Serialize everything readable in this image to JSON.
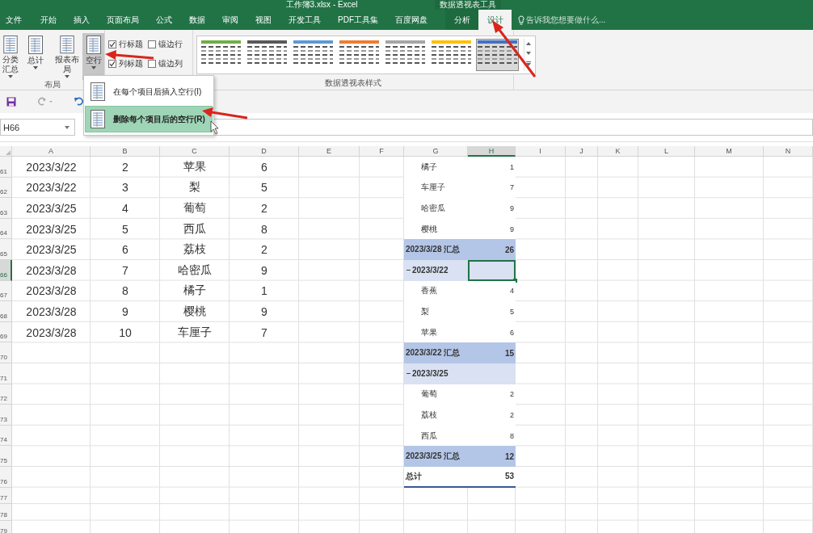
{
  "window": {
    "title": "工作簿3.xlsx - Excel",
    "context_label": "数据透视表工具"
  },
  "ribbon_tabs": [
    {
      "label": "文件",
      "kind": "normal",
      "selected": false
    },
    {
      "label": "开始",
      "kind": "normal",
      "selected": false
    },
    {
      "label": "插入",
      "kind": "normal",
      "selected": false
    },
    {
      "label": "页面布局",
      "kind": "normal",
      "selected": false
    },
    {
      "label": "公式",
      "kind": "normal",
      "selected": false
    },
    {
      "label": "数据",
      "kind": "normal",
      "selected": false
    },
    {
      "label": "审阅",
      "kind": "normal",
      "selected": false
    },
    {
      "label": "视图",
      "kind": "normal",
      "selected": false
    },
    {
      "label": "开发工具",
      "kind": "normal",
      "selected": false
    },
    {
      "label": "PDF工具集",
      "kind": "normal",
      "selected": false
    },
    {
      "label": "百度网盘",
      "kind": "normal",
      "selected": false
    },
    {
      "label": "分析",
      "kind": "context",
      "selected": false
    },
    {
      "label": "设计",
      "kind": "context",
      "selected": true
    }
  ],
  "tell_me": {
    "placeholder": "告诉我您想要做什么..."
  },
  "layout_group": {
    "label": "布局",
    "buttons": [
      {
        "label": "分类汇总",
        "pressed": false
      },
      {
        "label": "总计",
        "pressed": false
      },
      {
        "label": "报表布局",
        "pressed": false
      },
      {
        "label": "空行",
        "pressed": true
      }
    ]
  },
  "style_options": [
    {
      "label": "行标题",
      "checked": true
    },
    {
      "label": "镶边行",
      "checked": false
    },
    {
      "label": "列标题",
      "checked": true
    },
    {
      "label": "镶边列",
      "checked": false
    }
  ],
  "styles_group": {
    "label": "数据透视表样式",
    "swatches": [
      {
        "color": "#70ad47",
        "selected": false
      },
      {
        "color": "#595959",
        "selected": false
      },
      {
        "color": "#5b9bd5",
        "selected": false
      },
      {
        "color": "#ed7d31",
        "selected": false
      },
      {
        "color": "#a5a5a5",
        "selected": false
      },
      {
        "color": "#ffc000",
        "selected": false
      },
      {
        "color": "#4472c4",
        "selected": true
      }
    ]
  },
  "name_box": {
    "value": "H66"
  },
  "dropdown_menu": {
    "items": [
      {
        "label": "在每个项目后插入空行(I)",
        "selected": false
      },
      {
        "label": "删除每个项目后的空行(R)",
        "selected": true
      }
    ]
  },
  "sheet": {
    "columns": [
      {
        "label": "A",
        "selected": false
      },
      {
        "label": "B",
        "selected": false
      },
      {
        "label": "C",
        "selected": false
      },
      {
        "label": "D",
        "selected": false
      },
      {
        "label": "E",
        "selected": false
      },
      {
        "label": "F",
        "selected": false
      },
      {
        "label": "G",
        "selected": false
      },
      {
        "label": "H",
        "selected": true
      },
      {
        "label": "I",
        "selected": false
      },
      {
        "label": "J",
        "selected": false
      },
      {
        "label": "K",
        "selected": false
      },
      {
        "label": "L",
        "selected": false
      },
      {
        "label": "M",
        "selected": false
      },
      {
        "label": "N",
        "selected": false
      }
    ],
    "rows": [
      {
        "number": "61",
        "selected": false,
        "cells": [
          "2023/3/22",
          "2",
          "苹果",
          "6"
        ],
        "pivot": {
          "kind": "item",
          "label": "橘子",
          "value": "1"
        }
      },
      {
        "number": "62",
        "selected": false,
        "cells": [
          "2023/3/22",
          "3",
          "梨",
          "5"
        ],
        "pivot": {
          "kind": "item",
          "label": "车厘子",
          "value": "7"
        }
      },
      {
        "number": "63",
        "selected": false,
        "cells": [
          "2023/3/25",
          "4",
          "葡萄",
          "2"
        ],
        "pivot": {
          "kind": "item",
          "label": "哈密瓜",
          "value": "9"
        }
      },
      {
        "number": "64",
        "selected": false,
        "cells": [
          "2023/3/25",
          "5",
          "西瓜",
          "8"
        ],
        "pivot": {
          "kind": "item",
          "label": "樱桃",
          "value": "9"
        }
      },
      {
        "number": "65",
        "selected": false,
        "cells": [
          "2023/3/25",
          "6",
          "荔枝",
          "2"
        ],
        "pivot": {
          "kind": "subtotal",
          "label": "2023/3/28 汇总",
          "value": "26"
        }
      },
      {
        "number": "66",
        "selected": true,
        "cells": [
          "2023/3/28",
          "7",
          "哈密瓜",
          "9"
        ],
        "pivot": {
          "kind": "group",
          "label": "2023/3/22"
        }
      },
      {
        "number": "67",
        "selected": false,
        "cells": [
          "2023/3/28",
          "8",
          "橘子",
          "1"
        ],
        "pivot": {
          "kind": "item",
          "label": "香蕉",
          "value": "4"
        }
      },
      {
        "number": "68",
        "selected": false,
        "cells": [
          "2023/3/28",
          "9",
          "樱桃",
          "9"
        ],
        "pivot": {
          "kind": "item",
          "label": "梨",
          "value": "5"
        }
      },
      {
        "number": "69",
        "selected": false,
        "cells": [
          "2023/3/28",
          "10",
          "车厘子",
          "7"
        ],
        "pivot": {
          "kind": "item",
          "label": "苹果",
          "value": "6"
        }
      },
      {
        "number": "70",
        "selected": false,
        "pivot": {
          "kind": "subtotal",
          "label": "2023/3/22 汇总",
          "value": "15"
        }
      },
      {
        "number": "71",
        "selected": false,
        "pivot": {
          "kind": "group",
          "label": "2023/3/25"
        }
      },
      {
        "number": "72",
        "selected": false,
        "pivot": {
          "kind": "item",
          "label": "葡萄",
          "value": "2"
        }
      },
      {
        "number": "73",
        "selected": false,
        "pivot": {
          "kind": "item",
          "label": "荔枝",
          "value": "2"
        }
      },
      {
        "number": "74",
        "selected": false,
        "pivot": {
          "kind": "item",
          "label": "西瓜",
          "value": "8"
        }
      },
      {
        "number": "75",
        "selected": false,
        "pivot": {
          "kind": "subtotal",
          "label": "2023/3/25 汇总",
          "value": "12"
        }
      },
      {
        "number": "76",
        "selected": false,
        "pivot": {
          "kind": "total",
          "label": "总计",
          "value": "53"
        }
      },
      {
        "number": "77",
        "selected": false
      },
      {
        "number": "78",
        "selected": false
      },
      {
        "number": "79",
        "selected": false
      }
    ]
  }
}
